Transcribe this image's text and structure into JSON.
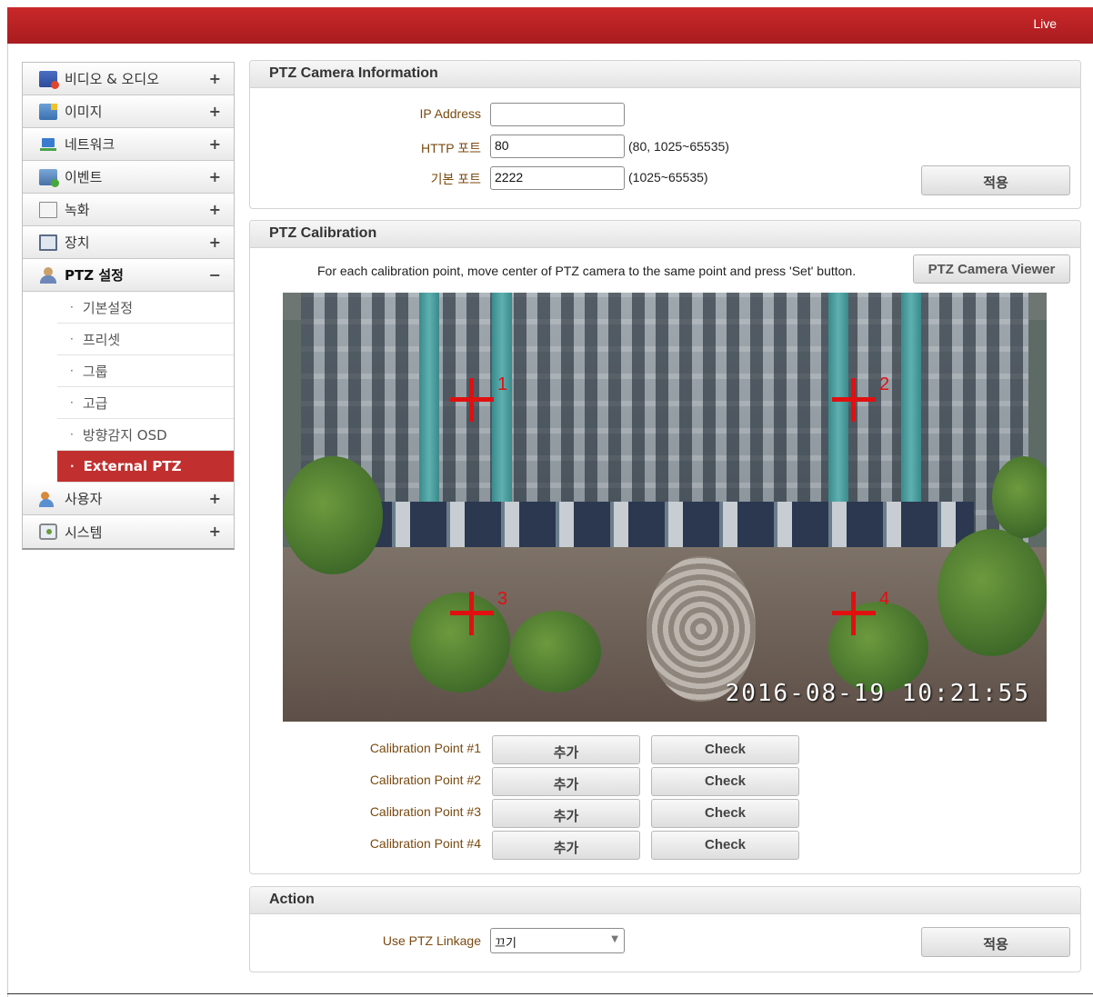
{
  "header": {
    "live_label": "Live"
  },
  "sidebar": {
    "items": [
      {
        "label": "비디오 & 오디오",
        "sign": "+",
        "icon": "video-audio-icon"
      },
      {
        "label": "이미지",
        "sign": "+",
        "icon": "image-icon"
      },
      {
        "label": "네트워크",
        "sign": "+",
        "icon": "network-icon"
      },
      {
        "label": "이벤트",
        "sign": "+",
        "icon": "event-icon"
      },
      {
        "label": "녹화",
        "sign": "+",
        "icon": "record-icon"
      },
      {
        "label": "장치",
        "sign": "+",
        "icon": "device-icon"
      },
      {
        "label": "PTZ 설정",
        "sign": "−",
        "icon": "ptz-user-icon"
      },
      {
        "label": "사용자",
        "sign": "+",
        "icon": "user-icon"
      },
      {
        "label": "시스템",
        "sign": "+",
        "icon": "system-icon"
      }
    ],
    "sub_items": [
      {
        "label": "기본설정"
      },
      {
        "label": "프리셋"
      },
      {
        "label": "그룹"
      },
      {
        "label": "고급"
      },
      {
        "label": "방향감지 OSD"
      },
      {
        "label": "External PTZ"
      }
    ],
    "bullet": "·"
  },
  "camera_info": {
    "title": "PTZ Camera Information",
    "ip_label": "IP Address",
    "ip_value": "",
    "http_label": "HTTP 포트",
    "http_value": "80",
    "http_hint": "(80, 1025~65535)",
    "base_label": "기본 포트",
    "base_value": "2222",
    "base_hint": "(1025~65535)",
    "apply_label": "적용"
  },
  "calibration": {
    "title": "PTZ Calibration",
    "instruction": "For each calibration point, move center of PTZ camera to the same point and press 'Set' button.",
    "viewer_button": "PTZ Camera Viewer",
    "timestamp": "2016-08-19 10:21:55",
    "markers": [
      "1",
      "2",
      "3",
      "4"
    ],
    "points": [
      {
        "label": "Calibration Point #1",
        "add": "추가",
        "check": "Check"
      },
      {
        "label": "Calibration Point #2",
        "add": "추가",
        "check": "Check"
      },
      {
        "label": "Calibration Point #3",
        "add": "추가",
        "check": "Check"
      },
      {
        "label": "Calibration Point #4",
        "add": "추가",
        "check": "Check"
      }
    ]
  },
  "action": {
    "title": "Action",
    "linkage_label": "Use PTZ Linkage",
    "linkage_value": "끄기",
    "apply_label": "적용"
  },
  "colors": {
    "brand_red": "#c1302f",
    "label_brown": "#7a4a10",
    "marker_red": "#e01010"
  }
}
